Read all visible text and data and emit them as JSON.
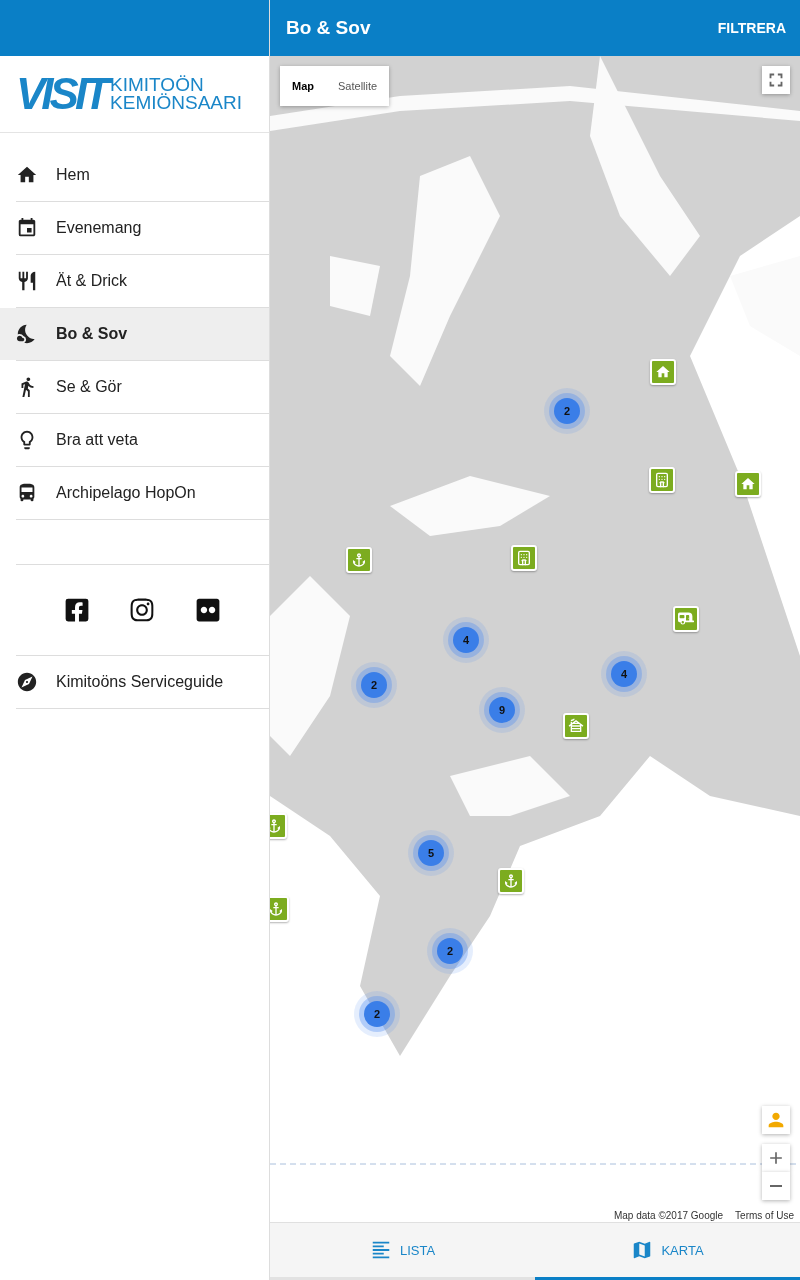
{
  "header": {
    "title": "Bo & Sov",
    "action": "FILTRERA"
  },
  "logo": {
    "mark": "VISIT",
    "line_1": "KIMITOÖN",
    "line_2": "KEMIÖNSAARI"
  },
  "menu": [
    {
      "kind": "home",
      "label": "Hem",
      "selected": false
    },
    {
      "kind": "event",
      "label": "Evenemang",
      "selected": false
    },
    {
      "kind": "food",
      "label": "Ät & Drick",
      "selected": false
    },
    {
      "kind": "sleep",
      "label": "Bo & Sov",
      "selected": true
    },
    {
      "kind": "walk",
      "label": "Se & Gör",
      "selected": false
    },
    {
      "kind": "idea",
      "label": "Bra att veta",
      "selected": false
    },
    {
      "kind": "bus",
      "label": "Archipelago HopOn",
      "selected": false
    }
  ],
  "social": [
    {
      "kind": "facebook"
    },
    {
      "kind": "instagram"
    },
    {
      "kind": "flickr"
    }
  ],
  "guide": {
    "label": "Kimitoöns Serviceguide"
  },
  "map": {
    "types": [
      {
        "label": "Map",
        "selected": true
      },
      {
        "label": "Satellite",
        "selected": false
      }
    ],
    "clusters": [
      {
        "count": "2"
      },
      {
        "count": "4"
      },
      {
        "count": "2"
      },
      {
        "count": "9"
      },
      {
        "count": "4"
      },
      {
        "count": "5"
      },
      {
        "count": "2"
      },
      {
        "count": "2"
      }
    ],
    "pins": [
      {
        "kind": "house"
      },
      {
        "kind": "hotel"
      },
      {
        "kind": "house"
      },
      {
        "kind": "anchor"
      },
      {
        "kind": "hotel"
      },
      {
        "kind": "camper"
      },
      {
        "kind": "cabin"
      },
      {
        "kind": "anchor"
      },
      {
        "kind": "anchor"
      },
      {
        "kind": "anchor"
      }
    ],
    "attribution": "Map data ©2017 Google",
    "terms": "Terms of Use"
  },
  "tabs": [
    {
      "kind": "list",
      "label": "LISTA",
      "selected": false
    },
    {
      "kind": "map",
      "label": "KARTA",
      "selected": true
    }
  ]
}
